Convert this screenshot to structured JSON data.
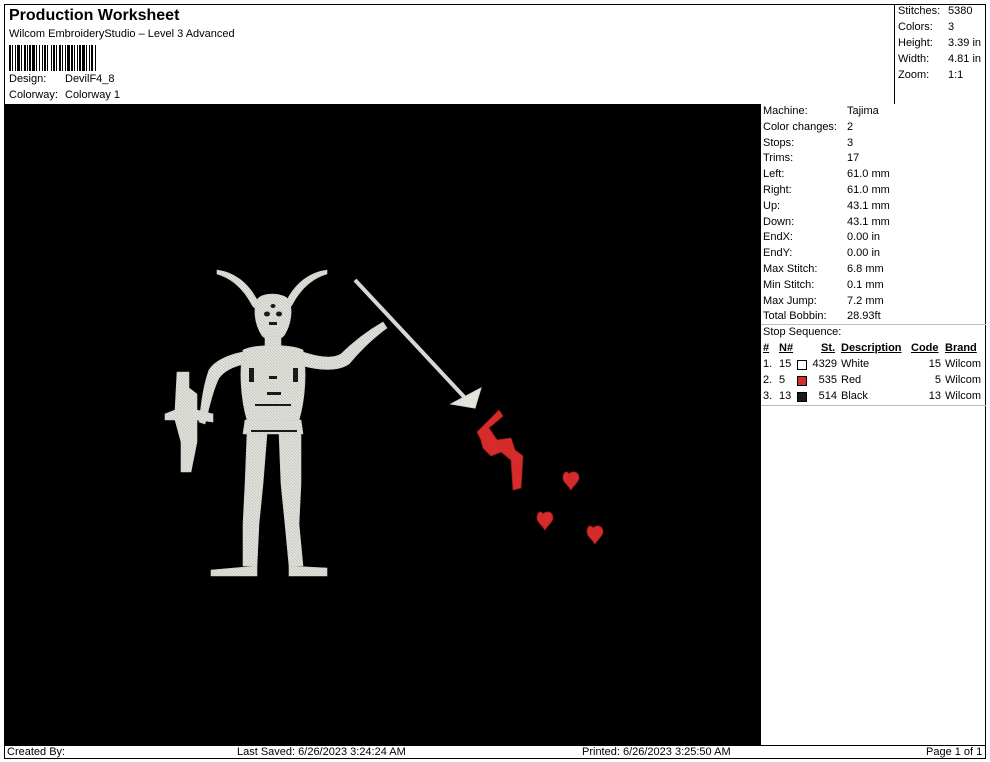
{
  "header": {
    "title": "Production Worksheet",
    "subtitle": "Wilcom EmbroideryStudio – Level 3 Advanced",
    "design_label": "Design:",
    "design_value": "DevilF4_8",
    "colorway_label": "Colorway:",
    "colorway_value": "Colorway 1"
  },
  "summary": [
    {
      "label": "Stitches:",
      "value": "5380"
    },
    {
      "label": "Colors:",
      "value": "3"
    },
    {
      "label": "Height:",
      "value": "3.39 in"
    },
    {
      "label": "Width:",
      "value": "4.81 in"
    },
    {
      "label": "Zoom:",
      "value": "1:1"
    }
  ],
  "machine_info": [
    {
      "label": "Machine:",
      "value": "Tajima"
    },
    {
      "label": "Color changes:",
      "value": "2"
    },
    {
      "label": "Stops:",
      "value": "3"
    },
    {
      "label": "Trims:",
      "value": "17"
    },
    {
      "label": "Left:",
      "value": "61.0 mm"
    },
    {
      "label": "Right:",
      "value": "61.0 mm"
    },
    {
      "label": "Up:",
      "value": "43.1 mm"
    },
    {
      "label": "Down:",
      "value": "43.1 mm"
    },
    {
      "label": "EndX:",
      "value": "0.00 in"
    },
    {
      "label": "EndY:",
      "value": "0.00 in"
    },
    {
      "label": "Max Stitch:",
      "value": "6.8 mm"
    },
    {
      "label": "Min Stitch:",
      "value": "0.1 mm"
    },
    {
      "label": "Max Jump:",
      "value": "7.2 mm"
    },
    {
      "label": "Total Bobbin:",
      "value": "28.93ft"
    }
  ],
  "stop_sequence": {
    "title": "Stop Sequence:",
    "columns": [
      "#",
      "N#",
      "St.",
      "Description",
      "Code",
      "Brand"
    ],
    "rows": [
      {
        "idx": "1.",
        "n": "15",
        "color": "#ffffff",
        "st": "4329",
        "desc": "White",
        "code": "15",
        "brand": "Wilcom"
      },
      {
        "idx": "2.",
        "n": "5",
        "color": "#d62b2b",
        "st": "535",
        "desc": "Red",
        "code": "5",
        "brand": "Wilcom"
      },
      {
        "idx": "3.",
        "n": "13",
        "color": "#1a1a1a",
        "st": "514",
        "desc": "Black",
        "code": "13",
        "brand": "Wilcom"
      }
    ]
  },
  "footer": {
    "created_by": "Created By:",
    "last_saved": "Last Saved: 6/26/2023 3:24:24 AM",
    "printed": "Printed: 6/26/2023 3:25:50 AM",
    "page": "Page 1 of 1"
  },
  "colors": {
    "background": "#000000",
    "thread_white": "#e6e6e0",
    "thread_red": "#d62b2b"
  }
}
